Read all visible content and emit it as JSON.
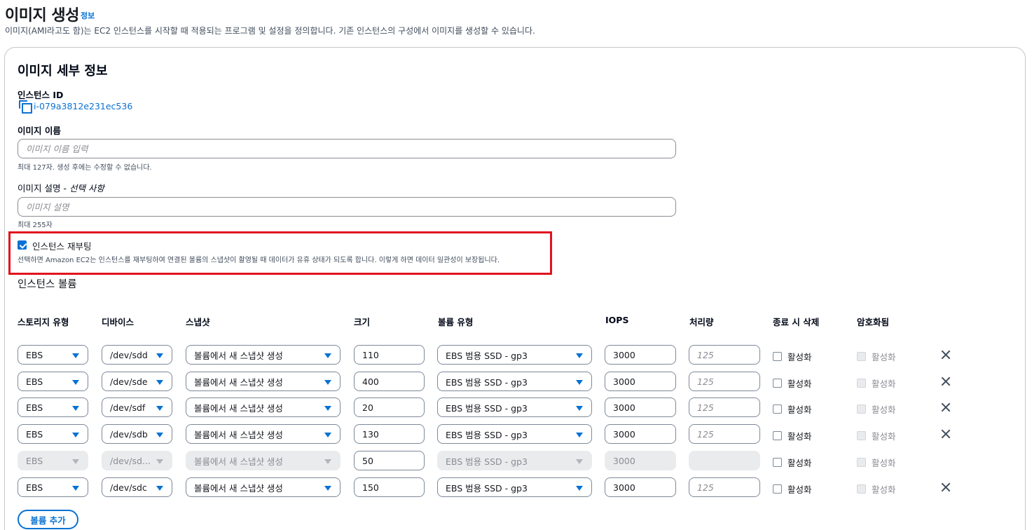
{
  "header": {
    "title": "이미지 생성",
    "info": "정보",
    "description": "이미지(AMI라고도 함)는 EC2 인스턴스를 시작할 때 적용되는 프로그램 및 설정을 정의합니다. 기존 인스턴스의 구성에서 이미지를 생성할 수 있습니다."
  },
  "details": {
    "section_title": "이미지 세부 정보",
    "instance_id_label": "인스턴스 ID",
    "instance_id": "i-079a3812e231ec536",
    "image_name_label": "이미지 이름",
    "image_name_placeholder": "이미지 이름 입력",
    "image_name_value": "",
    "image_name_hint": "최대 127자. 생성 후에는 수정할 수 없습니다.",
    "image_desc_label": "이미지 설명 - ",
    "image_desc_optional": "선택 사항",
    "image_desc_placeholder": "이미지 설명",
    "image_desc_value": "",
    "image_desc_hint": "최대 255자"
  },
  "reboot": {
    "label": "인스턴스 재부팅",
    "checked": true,
    "description": "선택하면 Amazon EC2는 인스턴스를 재부팅하여 연결된 볼륨의 스냅샷이 촬영될 때 데이터가 유휴 상태가 되도록 합니다. 이렇게 하면 데이터 일관성이 보장됩니다."
  },
  "volumes": {
    "title": "인스턴스 볼륨",
    "columns": [
      "스토리지 유형",
      "디바이스",
      "스냅샷",
      "크기",
      "볼륨 유형",
      "IOPS",
      "처리량",
      "종료 시 삭제",
      "암호화됨"
    ],
    "throughput_placeholder": "125",
    "checkbox_label": "활성화",
    "rows": [
      {
        "storage": "EBS",
        "device": "/dev/sdd",
        "snapshot": "볼륨에서 새 스냅샷 생성",
        "size": "110",
        "volume_type": "EBS 범용 SSD - gp3",
        "iops": "3000",
        "throughput": "",
        "disabled": false,
        "removable": true
      },
      {
        "storage": "EBS",
        "device": "/dev/sde",
        "snapshot": "볼륨에서 새 스냅샷 생성",
        "size": "400",
        "volume_type": "EBS 범용 SSD - gp3",
        "iops": "3000",
        "throughput": "",
        "disabled": false,
        "removable": true
      },
      {
        "storage": "EBS",
        "device": "/dev/sdf",
        "snapshot": "볼륨에서 새 스냅샷 생성",
        "size": "20",
        "volume_type": "EBS 범용 SSD - gp3",
        "iops": "3000",
        "throughput": "",
        "disabled": false,
        "removable": true
      },
      {
        "storage": "EBS",
        "device": "/dev/sdb",
        "snapshot": "볼륨에서 새 스냅샷 생성",
        "size": "130",
        "volume_type": "EBS 범용 SSD - gp3",
        "iops": "3000",
        "throughput": "",
        "disabled": false,
        "removable": true
      },
      {
        "storage": "EBS",
        "device": "/dev/sd...",
        "snapshot": "볼륨에서 새 스냅샷 생성",
        "size": "50",
        "volume_type": "EBS 범용 SSD - gp3",
        "iops": "3000",
        "throughput": "",
        "disabled": true,
        "removable": false
      },
      {
        "storage": "EBS",
        "device": "/dev/sdc",
        "snapshot": "볼륨에서 새 스냅샷 생성",
        "size": "150",
        "volume_type": "EBS 범용 SSD - gp3",
        "iops": "3000",
        "throughput": "",
        "disabled": false,
        "removable": true
      }
    ],
    "add_button": "볼륨 추가"
  },
  "colors": {
    "accent": "#0972d3",
    "highlight": "#e0141e"
  }
}
